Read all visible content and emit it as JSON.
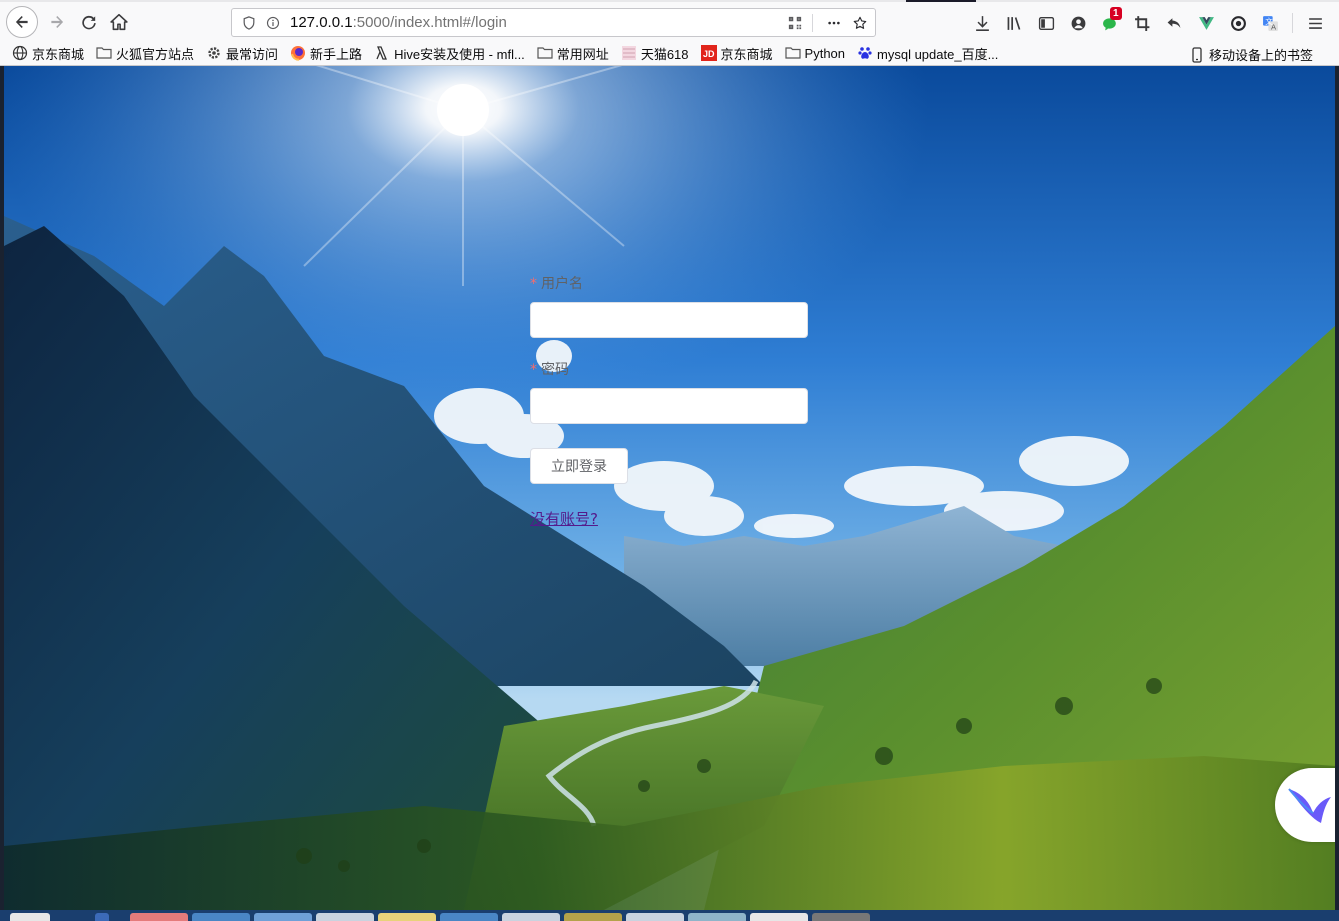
{
  "browser": {
    "url_host": "127.0.0.1",
    "url_path": ":5000/index.html#/login",
    "notification_count": "1"
  },
  "bookmarks": [
    {
      "label": "京东商城",
      "icon": "globe-icon"
    },
    {
      "label": "火狐官方站点",
      "icon": "folder-icon"
    },
    {
      "label": "最常访问",
      "icon": "gear-icon"
    },
    {
      "label": "新手上路",
      "icon": "firefox-icon"
    },
    {
      "label": "Hive安装及使用 - mfl...",
      "icon": "bookmark-icon"
    },
    {
      "label": "常用网址",
      "icon": "folder-icon"
    },
    {
      "label": "天猫618",
      "icon": "tmall-icon"
    },
    {
      "label": "京东商城",
      "icon": "jd-icon"
    },
    {
      "label": "Python",
      "icon": "folder-icon"
    },
    {
      "label": "mysql update_百度...",
      "icon": "baidu-icon"
    }
  ],
  "mobile_bookmarks": "移动设备上的书签",
  "login": {
    "username_label": "用户名",
    "username_value": "",
    "password_label": "密码",
    "password_value": "",
    "required_mark": "*",
    "submit_label": "立即登录",
    "register_link": "没有账号?"
  },
  "colors": {
    "required": "#f56c6c",
    "link_visited": "#551a8b",
    "label": "#606266"
  }
}
